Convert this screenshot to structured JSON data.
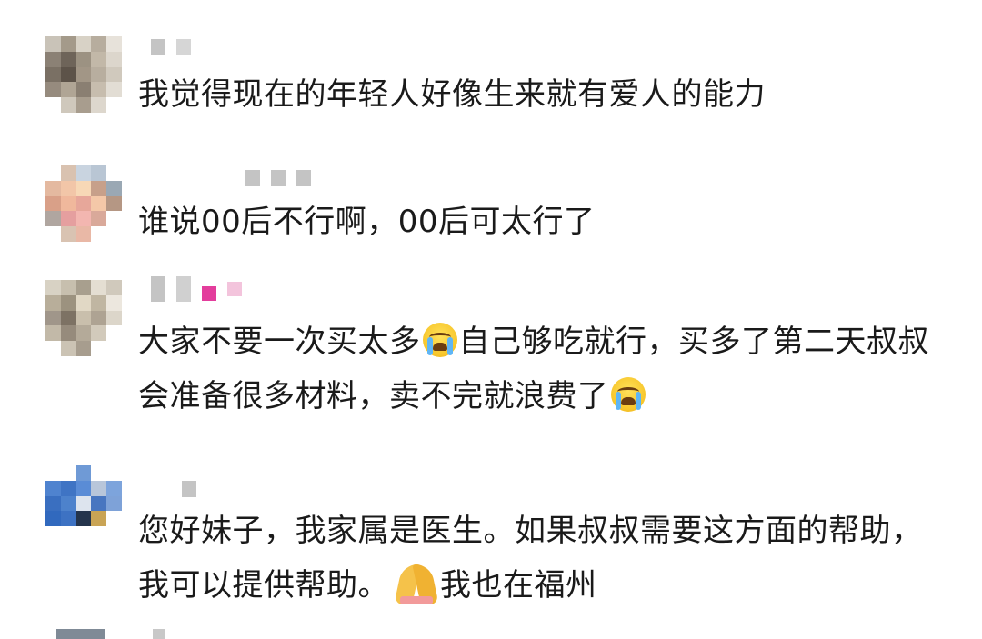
{
  "comments": [
    {
      "text": "我觉得现在的年轻人好像生来就有爱人的能力"
    },
    {
      "text": "谁说00后不行啊，00后可太行了"
    },
    {
      "text_part1": "大家不要一次买太多",
      "text_part2": "自己够吃就行，买多了第二天叔叔会准备很多材料，卖不完就浪费了",
      "emoji": "loudly-crying-face-icon"
    },
    {
      "text_part1": "您好妹子，我家属是医生。如果叔叔需要这方面的帮助，我可以提供帮助。",
      "text_part2": "我也在福州",
      "emoji": "folded-hands-icon"
    }
  ],
  "colors": {
    "text": "#1a1a1a",
    "emoji_yellow": "#f7c52a",
    "tear_blue": "#5fb6f5"
  }
}
